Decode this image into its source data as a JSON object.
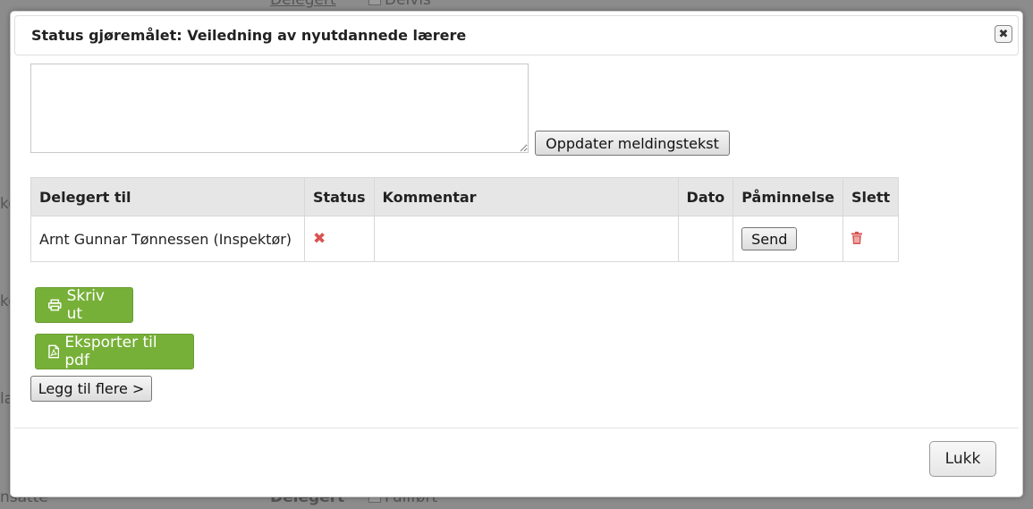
{
  "background": {
    "top_link": "Delegert",
    "top_checkbox_label": "Delvis",
    "bottom_left_text": "nsatte",
    "bottom_cell_text": "Delegert",
    "bottom_checkbox_label": "Fullført",
    "left_fragments": [
      "ko",
      "ko",
      "la"
    ]
  },
  "modal": {
    "title": "Status gjøremålet: Veiledning av nyutdannede lærere",
    "close_icon": "close-icon",
    "message_text": "",
    "update_button": "Oppdater meldingstekst",
    "table": {
      "headers": [
        "Delegert til",
        "Status",
        "Kommentar",
        "Dato",
        "Påminnelse",
        "Slett"
      ],
      "rows": [
        {
          "delegated_to": "Arnt Gunnar Tønnessen (Inspektør)",
          "status_icon": "x-icon",
          "status_color": "#d9534f",
          "comment": "",
          "date": "",
          "reminder_button": "Send",
          "delete_icon": "trash-icon"
        }
      ]
    },
    "print_button": "Skriv ut",
    "print_icon": "printer-icon",
    "export_button": "Eksporter til pdf",
    "export_icon": "pdf-file-icon",
    "add_more_button": "Legg til flere >",
    "close_button": "Lukk",
    "accent_color": "#77b038"
  }
}
